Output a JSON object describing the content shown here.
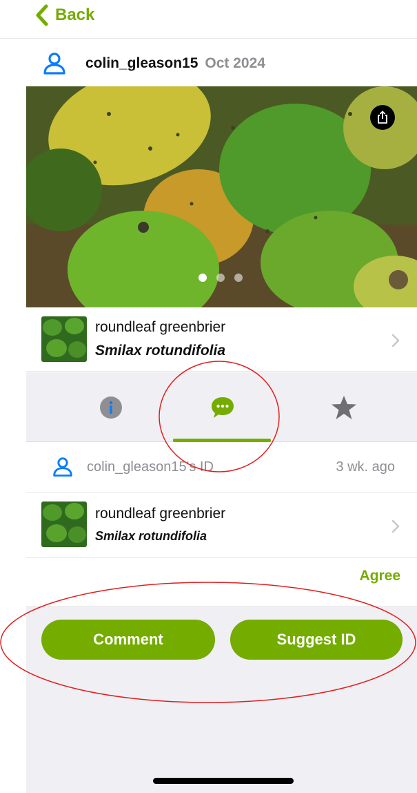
{
  "nav": {
    "back_label": "Back"
  },
  "observation": {
    "user": "colin_gleason15",
    "date": "Oct 2024",
    "photo_count": 3,
    "active_photo_index": 0,
    "taxon": {
      "common_name": "roundleaf greenbrier",
      "scientific_name": "Smilax rotundifolia"
    }
  },
  "tabs": [
    {
      "name": "info",
      "icon": "info-icon"
    },
    {
      "name": "activity",
      "icon": "chat-bubble-icon",
      "active": true
    },
    {
      "name": "favorites",
      "icon": "star-icon"
    }
  ],
  "identification": {
    "user_label": "colin_gleason15's ID",
    "time_ago": "3 wk. ago",
    "common_name": "roundleaf greenbrier",
    "scientific_name": "Smilax rotundifolia",
    "agree_label": "Agree"
  },
  "actions": {
    "comment_label": "Comment",
    "suggest_label": "Suggest ID"
  },
  "colors": {
    "accent": "#74ac00",
    "user_icon": "#0a7cff",
    "annotation": "#e0201e",
    "panel_bg": "#f0eff4"
  }
}
